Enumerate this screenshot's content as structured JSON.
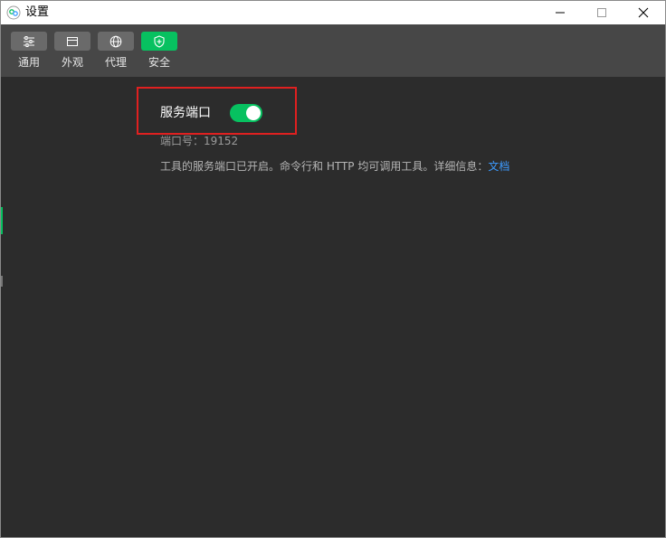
{
  "window": {
    "title": "设置",
    "icon": "wechat-devtools-app-icon"
  },
  "toolbar": {
    "items": [
      {
        "label": "通用",
        "icon": "sliders-icon",
        "active": false
      },
      {
        "label": "外观",
        "icon": "window-layout-icon",
        "active": false
      },
      {
        "label": "代理",
        "icon": "globe-icon",
        "active": false
      },
      {
        "label": "安全",
        "icon": "shield-icon",
        "active": true
      }
    ]
  },
  "security": {
    "service_port_label": "服务端口",
    "service_port_enabled": true,
    "port_text": "端口号：19152",
    "description": "工具的服务端口已开启。命令行和 HTTP 均可调用工具。详细信息：",
    "doc_link": "文档"
  },
  "colors": {
    "accent": "#07c160",
    "highlight_border": "#e02020",
    "link": "#3d9bff",
    "background": "#2c2c2c",
    "toolbar": "#474747"
  }
}
